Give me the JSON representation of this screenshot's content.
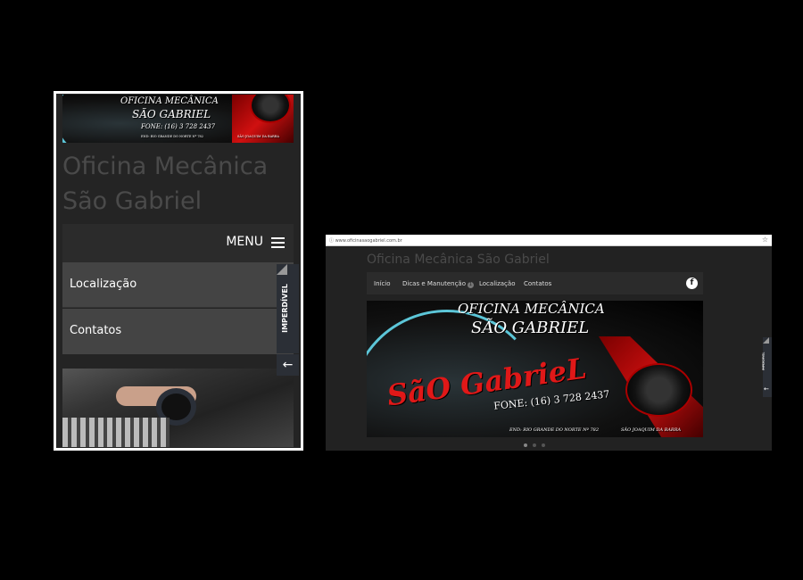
{
  "mobile": {
    "banner": {
      "line1": "OFICINA MECÂNICA",
      "line2": "SÃO GABRIEL",
      "phone": "FONE: (16) 3 728 2437",
      "address": "END: RIO GRANDE DO NORTE Nº 782",
      "city": "SÃO JOAQUIM DA BARRA"
    },
    "site_title": "Oficina Mecânica São Gabriel",
    "menu_label": "MENU",
    "menu_items": [
      {
        "label": "Localização"
      },
      {
        "label": "Contatos"
      }
    ],
    "side_tab": "IMPERDÍVEL",
    "icons": {
      "menu": "hamburger-icon",
      "back": "arrow-left-icon"
    }
  },
  "desktop": {
    "url": "www.oficinasaogabriel.com.br",
    "site_title": "Oficina Mecânica São Gabriel",
    "nav": [
      {
        "label": "Início"
      },
      {
        "label": "Dicas e Manutenção",
        "badge": "1"
      },
      {
        "label": "Localização"
      },
      {
        "label": "Contatos"
      }
    ],
    "facebook": "f",
    "banner": {
      "line1": "OFICINA MECÂNICA",
      "line2": "SÃO GABRIEL",
      "big": "SãO GabrieL",
      "phone": "FONE: (16) 3 728 2437",
      "address": "END: RIO GRANDE DO NORTE Nº 782",
      "city": "SÃO JOAQUIM DA BARRA"
    },
    "slider_dots": 3,
    "active_dot": 1,
    "side_tab": "IMPERDÍVEL"
  },
  "colors": {
    "background": "#000000",
    "page": "#222222",
    "menu_item": "#444444",
    "accent_red": "#d01010",
    "dial": "#5cc6d8"
  }
}
